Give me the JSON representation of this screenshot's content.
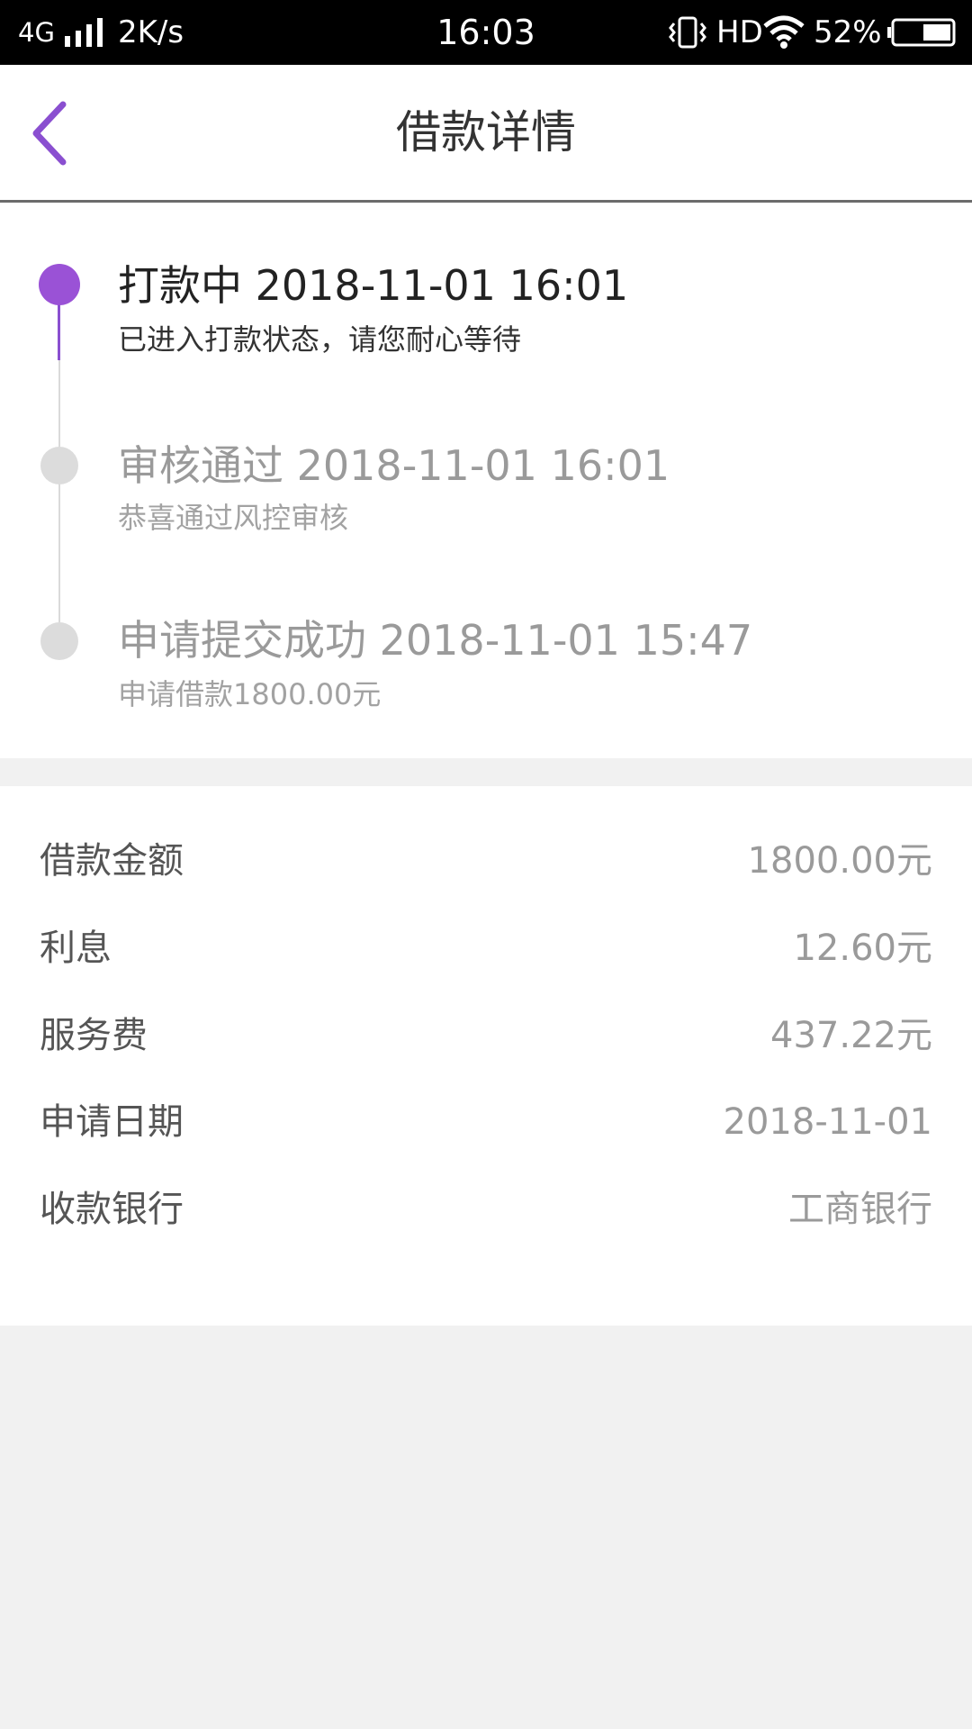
{
  "status_bar": {
    "network": "4G",
    "speed": "2K/s",
    "time": "16:03",
    "hd": "HD",
    "battery": "52%"
  },
  "header": {
    "title": "借款详情",
    "back_icon": "chevron-left-icon",
    "accent_color": "#8a4fd0"
  },
  "timeline": [
    {
      "status": "active",
      "title": "打款中 2018-11-01 16:01",
      "desc": "已进入打款状态，请您耐心等待"
    },
    {
      "status": "done",
      "title": "审核通过 2018-11-01 16:01",
      "desc": "恭喜通过风控审核"
    },
    {
      "status": "done",
      "title": "申请提交成功 2018-11-01 15:47",
      "desc": "申请借款1800.00元"
    }
  ],
  "details": [
    {
      "label": "借款金额",
      "value": "1800.00元"
    },
    {
      "label": "利息",
      "value": "12.60元"
    },
    {
      "label": "服务费",
      "value": "437.22元"
    },
    {
      "label": "申请日期",
      "value": "2018-11-01"
    },
    {
      "label": "收款银行",
      "value": "工商银行"
    }
  ]
}
